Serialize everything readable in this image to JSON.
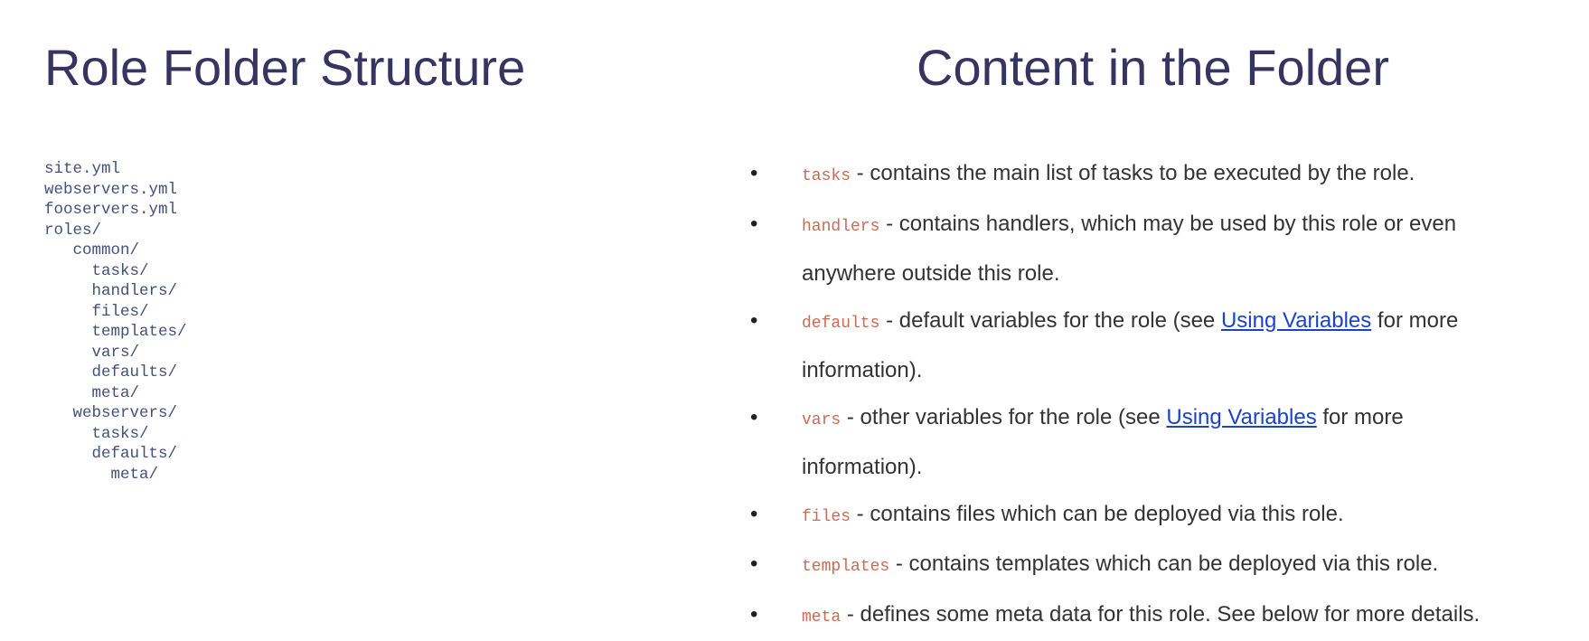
{
  "left": {
    "title": "Role Folder Structure",
    "tree": [
      "site.yml",
      "webservers.yml",
      "fooservers.yml",
      "roles/",
      "   common/",
      "     tasks/",
      "     handlers/",
      "     files/",
      "     templates/",
      "     vars/",
      "     defaults/",
      "     meta/",
      "   webservers/",
      "     tasks/",
      "     defaults/",
      "       meta/"
    ]
  },
  "right": {
    "title": "Content in the Folder",
    "items": [
      {
        "code": "tasks",
        "text": " - contains the main list of tasks to be executed by the role."
      },
      {
        "code": "handlers",
        "text": " - contains handlers, which may be used by this role or even",
        "text2": "anywhere outside this role."
      },
      {
        "code": "defaults",
        "pre": " - default variables for the role (see ",
        "link": "Using Variables",
        "post": " for more",
        "text2": "information)."
      },
      {
        "code": "vars",
        "pre": " - other variables for the role (see ",
        "link": "Using Variables",
        "post": " for more",
        "text2": "information)."
      },
      {
        "code": "files",
        "text": " - contains files which can be deployed via this role."
      },
      {
        "code": "templates",
        "text": " - contains templates which can be deployed via this role."
      },
      {
        "code": "meta",
        "text": " - defines some meta data for this role. See below for more details."
      }
    ]
  }
}
